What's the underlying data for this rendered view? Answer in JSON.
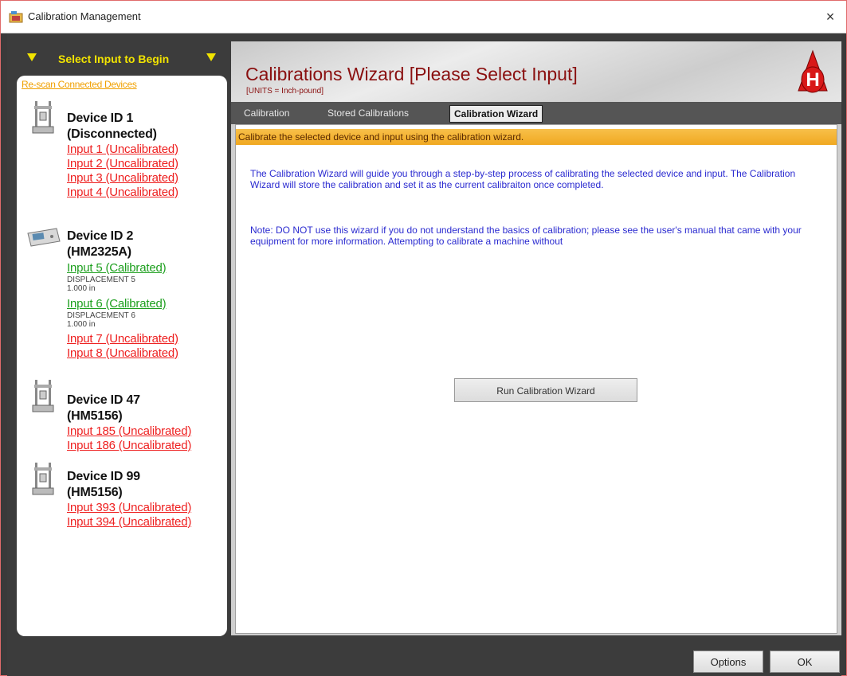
{
  "window": {
    "title": "Calibration Management",
    "close_label": "×"
  },
  "left": {
    "header_label": "Select Input to Begin",
    "rescan_label": "Re-scan Connected Devices",
    "devices": [
      {
        "name": "Device ID 1",
        "model": "(Disconnected)",
        "inputs": [
          {
            "label": "Input 1 (Uncalibrated)",
            "status": "uncalibrated"
          },
          {
            "label": "Input 2 (Uncalibrated)",
            "status": "uncalibrated"
          },
          {
            "label": "Input 3 (Uncalibrated)",
            "status": "uncalibrated"
          },
          {
            "label": "Input 4 (Uncalibrated)",
            "status": "uncalibrated"
          }
        ]
      },
      {
        "name": "Device ID 2",
        "model": "(HM2325A)",
        "inputs": [
          {
            "label": "Input 5 (Calibrated)",
            "status": "calibrated",
            "detail": "DISPLACEMENT 5",
            "value": "1.000 in"
          },
          {
            "label": "Input 6 (Calibrated)",
            "status": "calibrated",
            "detail": "DISPLACEMENT 6",
            "value": "1.000 in"
          },
          {
            "label": "Input 7 (Uncalibrated)",
            "status": "uncalibrated"
          },
          {
            "label": "Input 8 (Uncalibrated)",
            "status": "uncalibrated"
          }
        ]
      },
      {
        "name": "Device ID 47",
        "model": "(HM5156)",
        "inputs": [
          {
            "label": "Input 185 (Uncalibrated)",
            "status": "uncalibrated"
          },
          {
            "label": "Input 186 (Uncalibrated)",
            "status": "uncalibrated"
          }
        ]
      },
      {
        "name": "Device ID 99",
        "model": "(HM5156)",
        "inputs": [
          {
            "label": "Input 393 (Uncalibrated)",
            "status": "uncalibrated"
          },
          {
            "label": "Input 394 (Uncalibrated)",
            "status": "uncalibrated"
          }
        ]
      }
    ]
  },
  "right": {
    "title": "Calibrations Wizard [Please Select Input]",
    "units": "[UNITS = Inch-pound]",
    "logo_letter": "H",
    "tabs": [
      {
        "label": "Calibration",
        "active": false
      },
      {
        "label": "Stored Calibrations",
        "active": false
      },
      {
        "label": "Calibration Wizard",
        "active": true
      }
    ],
    "description": "Calibrate the selected device and input using the calibration wizard.",
    "intro_text": "The Calibration Wizard will guide you through a step-by-step process of calibrating the selected device and input.  The Calibration Wizard will store the calibration and set it as the current calibraiton once completed.",
    "note_text": "Note: DO NOT use this wizard if you do not understand the basics of calibration; please see the user's manual that came with your equipment for more information.  Attempting to calibrate a machine without",
    "run_button_label": "Run Calibration Wizard"
  },
  "footer": {
    "options_label": "Options",
    "ok_label": "OK"
  },
  "colors": {
    "uncalibrated": "#ee2020",
    "calibrated": "#1fa020",
    "header_yellow": "#f2e400",
    "title_red": "#8a1010",
    "body_blue": "#2a2ad0"
  }
}
